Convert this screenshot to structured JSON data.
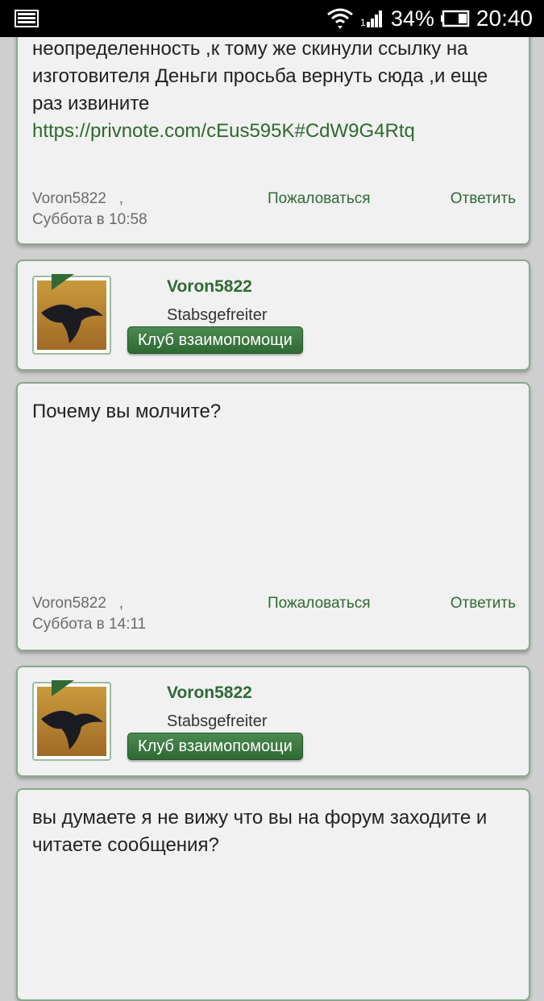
{
  "status_bar": {
    "battery_percent": "34%",
    "time": "20:40"
  },
  "posts": [
    {
      "text_lines": [
        "неопределенность ,к тому же скинули ссылку на",
        "изготовителя Деньги просьба вернуть сюда ,и еще",
        "раз извините"
      ],
      "link": "https://privnote.com/cEus595K#CdW9G4Rtq",
      "author": "Voron5822",
      "separator": ",",
      "date": "Суббота в 10:58",
      "report_label": "Пожаловаться",
      "reply_label": "Ответить"
    },
    {
      "text": "Почему вы молчите?",
      "author": "Voron5822",
      "separator": ",",
      "date": "Суббота в 14:11",
      "report_label": "Пожаловаться",
      "reply_label": "Ответить"
    },
    {
      "text_lines": [
        "вы думаете я не вижу что вы на форум заходите и",
        "читаете сообщения?"
      ]
    }
  ],
  "users": [
    {
      "name": "Voron5822",
      "rank": "Stabsgefreiter",
      "club": "Клуб взаимопомощи"
    },
    {
      "name": "Voron5822",
      "rank": "Stabsgefreiter",
      "club": "Клуб взаимопомощи"
    }
  ]
}
